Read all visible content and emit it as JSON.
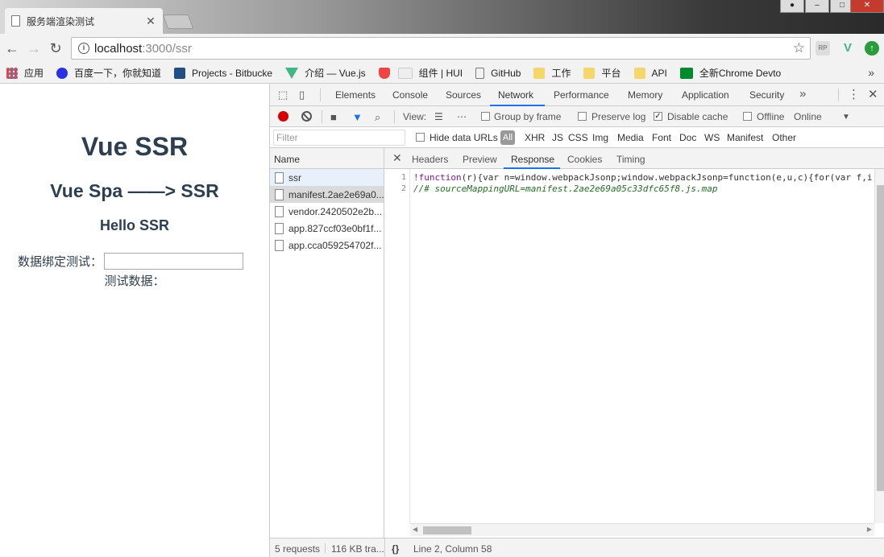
{
  "browser": {
    "tab_title": "服务端渲染测试",
    "url_host": "localhost",
    "url_path": ":3000/ssr"
  },
  "bookmarks": [
    {
      "label": "应用",
      "icon": "apps-grid-icon",
      "color": "#e8453c"
    },
    {
      "label": "百度一下，你就知道",
      "icon": "baidu-paw-icon",
      "color": "#2932e1"
    },
    {
      "label": "Projects - Bitbucke",
      "icon": "bitbucket-icon",
      "color": "#205081"
    },
    {
      "label": "介绍 — Vue.js",
      "icon": "vue-icon",
      "color": "#41b883"
    },
    {
      "label": "",
      "icon": "shield-icon",
      "color": "#e44"
    },
    {
      "label": "组件 | HUI",
      "icon": "blank-page-icon",
      "color": "#ddd"
    },
    {
      "label": "GitHub",
      "icon": "page-icon",
      "color": "#fff"
    },
    {
      "label": "工作",
      "icon": "folder-icon",
      "color": "#f5d66a"
    },
    {
      "label": "平台",
      "icon": "folder-icon",
      "color": "#f5d66a"
    },
    {
      "label": "API",
      "icon": "folder-icon",
      "color": "#f5d66a"
    },
    {
      "label": "全新Chrome Devto",
      "icon": "sf-icon",
      "color": "#008a30"
    }
  ],
  "page": {
    "h1": "Vue SSR",
    "h2": "Vue Spa ——> SSR",
    "h3": "Hello SSR",
    "bind_label": "数据绑定测试：",
    "bind_value": "",
    "output_label": "测试数据："
  },
  "devtools": {
    "tabs": [
      "Elements",
      "Console",
      "Sources",
      "Network",
      "Performance",
      "Memory",
      "Application",
      "Security"
    ],
    "active_tab": "Network",
    "net_toolbar": {
      "view_label": "View:",
      "group_by_frame": "Group by frame",
      "preserve_log": "Preserve log",
      "disable_cache": "Disable cache",
      "offline": "Offline",
      "throttle": "Online"
    },
    "filter": {
      "placeholder": "Filter",
      "hide_data_urls": "Hide data URLs",
      "types": [
        "All",
        "XHR",
        "JS",
        "CSS",
        "Img",
        "Media",
        "Font",
        "Doc",
        "WS",
        "Manifest",
        "Other"
      ]
    },
    "requests_header": "Name",
    "requests": [
      "ssr",
      "manifest.2ae2e69a0...",
      "vendor.2420502e2b...",
      "app.827ccf03e0bf1f...",
      "app.cca059254702f..."
    ],
    "detail_tabs": [
      "Headers",
      "Preview",
      "Response",
      "Cookies",
      "Timing"
    ],
    "active_detail_tab": "Response",
    "response_lines": [
      {
        "num": "1",
        "kw": "!function",
        "rest": "(r){var n=window.webpackJsonp;window.webpackJsonp=function(e,u,c){for(var f,i,"
      },
      {
        "num": "2",
        "comment": "//# sourceMappingURL=manifest.2ae2e69a05c33dfc65f8.js.map"
      }
    ],
    "status": {
      "requests": "5 requests",
      "transferred": "116 KB tra...",
      "position": "Line 2, Column 58"
    }
  }
}
